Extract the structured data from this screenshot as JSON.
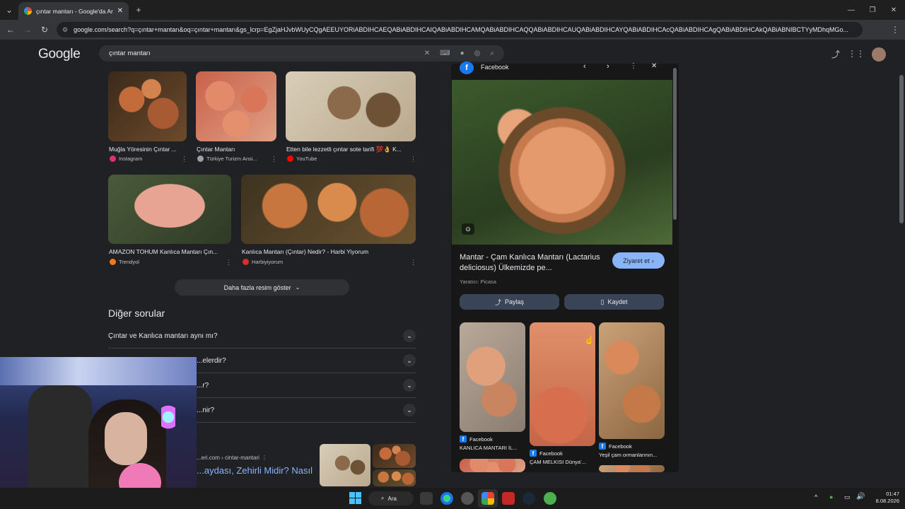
{
  "browser": {
    "tab_title": "çıntar mantarı - Google'da Ara",
    "url": "google.com/search?q=çıntar+mantarı&oq=çıntar+mantarı&gs_lcrp=EgZjaHJvbWUyCQgAEEUYORiABDIHCAEQABiABDIHCAIQABiABDIHCAMQABiABDIHCAQQABiABDIHCAUQABiABDIHCAYQABiABDIHCAcQABiABDIHCAgQABiABDIHCAkQABiABNIBCTYyMDhqMGo..."
  },
  "google": {
    "logo": "Google",
    "query": "çıntar mantarı"
  },
  "images": [
    {
      "caption": "Muğla Yöresinin Çıntar ...",
      "source": "Instagram",
      "color": "#e1306c"
    },
    {
      "caption": "Çıntar Mantarı",
      "source": "Türkiye Turizm Ansi...",
      "color": "#9aa0a6"
    },
    {
      "caption": "Etten bile lezzetli çıntar sote tarifi 💯👌 K...",
      "source": "YouTube",
      "color": "#ff0000"
    },
    {
      "caption": "AMAZON TOHUM Kanlıca Mantarı Çın...",
      "source": "Trendyol",
      "color": "#f27a1a"
    },
    {
      "caption": "Kanlıca Mantarı (Çıntar) Nedir? - Harbi Yiyorum",
      "source": "Harbiyiyorum",
      "color": "#d32f2f"
    }
  ],
  "more_images": "Daha fazla resim göster",
  "paa": {
    "title": "Diğer sorular",
    "questions": [
      "Çıntar ve Kanlıca mantarı aynı mı?",
      "...elerdir?",
      "...r?",
      "...nir?"
    ]
  },
  "result": {
    "breadcrumb": "...eri.com › cintar-mantari",
    "title": "...aydası, Zehirli Midir? Nasıl"
  },
  "panel": {
    "source": "Facebook",
    "title": "Mantar - Çam Kanlıca Mantarı (Lactarius deliciosus) Ülkemizde pe...",
    "visit": "Ziyaret et",
    "credit": "Yaratıcı: Picasa",
    "share": "Paylaş",
    "save": "Kaydet",
    "related": [
      {
        "source": "Facebook",
        "caption": "KANLICA MANTARI İL..."
      },
      {
        "source": "Facebook",
        "caption": "ÇAM MELKISI Dünya'..."
      },
      {
        "source": "Facebook",
        "caption": "Yeşil çam ormanlarının..."
      }
    ]
  },
  "taskbar": {
    "search": "Ara",
    "time": "01:47",
    "date": "8.08.2026"
  }
}
